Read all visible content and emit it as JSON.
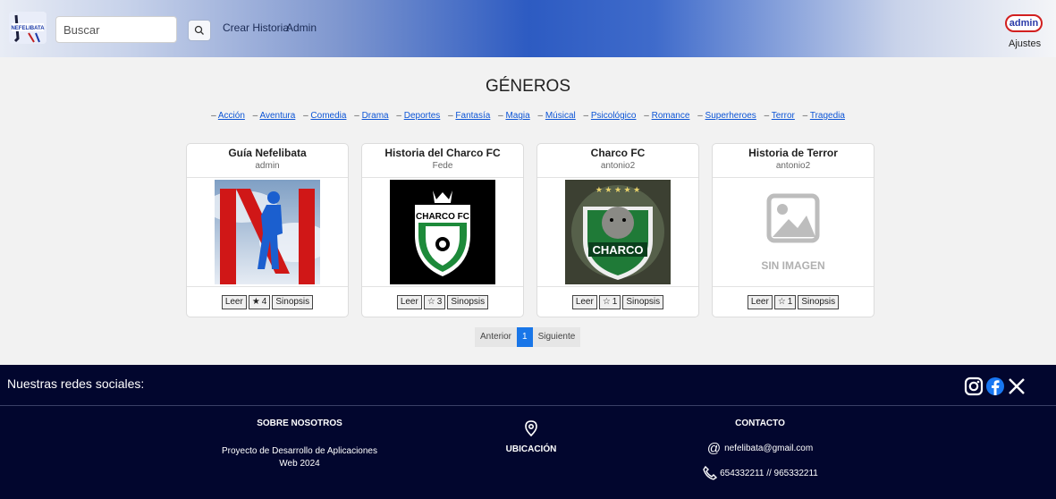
{
  "header": {
    "logo_text": "NEFELIBATA",
    "search_placeholder": "Buscar",
    "nav": [
      "Crear Historia",
      "Admin"
    ],
    "user": "admin",
    "settings": "Ajustes"
  },
  "genres": {
    "title": "GÉNEROS",
    "items": [
      "Acción",
      "Aventura",
      "Comedia",
      "Drama",
      "Deportes",
      "Fantasía",
      "Magia",
      "Músical",
      "Psicológico",
      "Romance",
      "Superheroes",
      "Terror",
      "Tragedia"
    ]
  },
  "cards": [
    {
      "title": "Guía Nefelibata",
      "author": "admin",
      "read": "Leer",
      "rating": "4",
      "rating_icon": "star-filled-icon",
      "synopsis": "Sinopsis"
    },
    {
      "title": "Historia del Charco FC",
      "author": "Fede",
      "read": "Leer",
      "rating": "3",
      "rating_icon": "star-outline-icon",
      "synopsis": "Sinopsis",
      "image_text": "CHARCO FC"
    },
    {
      "title": "Charco FC",
      "author": "antonio2",
      "read": "Leer",
      "rating": "1",
      "rating_icon": "star-outline-icon",
      "synopsis": "Sinopsis",
      "image_text": "CHARCO"
    },
    {
      "title": "Historia de Terror",
      "author": "antonio2",
      "read": "Leer",
      "rating": "1",
      "rating_icon": "star-outline-icon",
      "synopsis": "Sinopsis",
      "image_text": "SIN IMAGEN"
    }
  ],
  "pagination": {
    "prev": "Anterior",
    "current": "1",
    "next": "Siguiente"
  },
  "footer": {
    "social_title": "Nuestras redes sociales:",
    "social_icons": [
      "instagram-icon",
      "facebook-icon",
      "x-icon"
    ],
    "about": {
      "heading": "SOBRE NOSOTROS",
      "line1": "Proyecto de Desarrollo de Aplicaciones",
      "line2": "Web 2024"
    },
    "location": {
      "heading": "UBICACIÓN"
    },
    "contact": {
      "heading": "CONTACTO",
      "email": "nefelibata@gmail.com",
      "phone": "654332211 // 965332211"
    }
  },
  "colors": {
    "footer_bg": "#02062e",
    "accent": "#1976e8",
    "link": "#0d55d6",
    "user_border": "#d21f1f"
  }
}
